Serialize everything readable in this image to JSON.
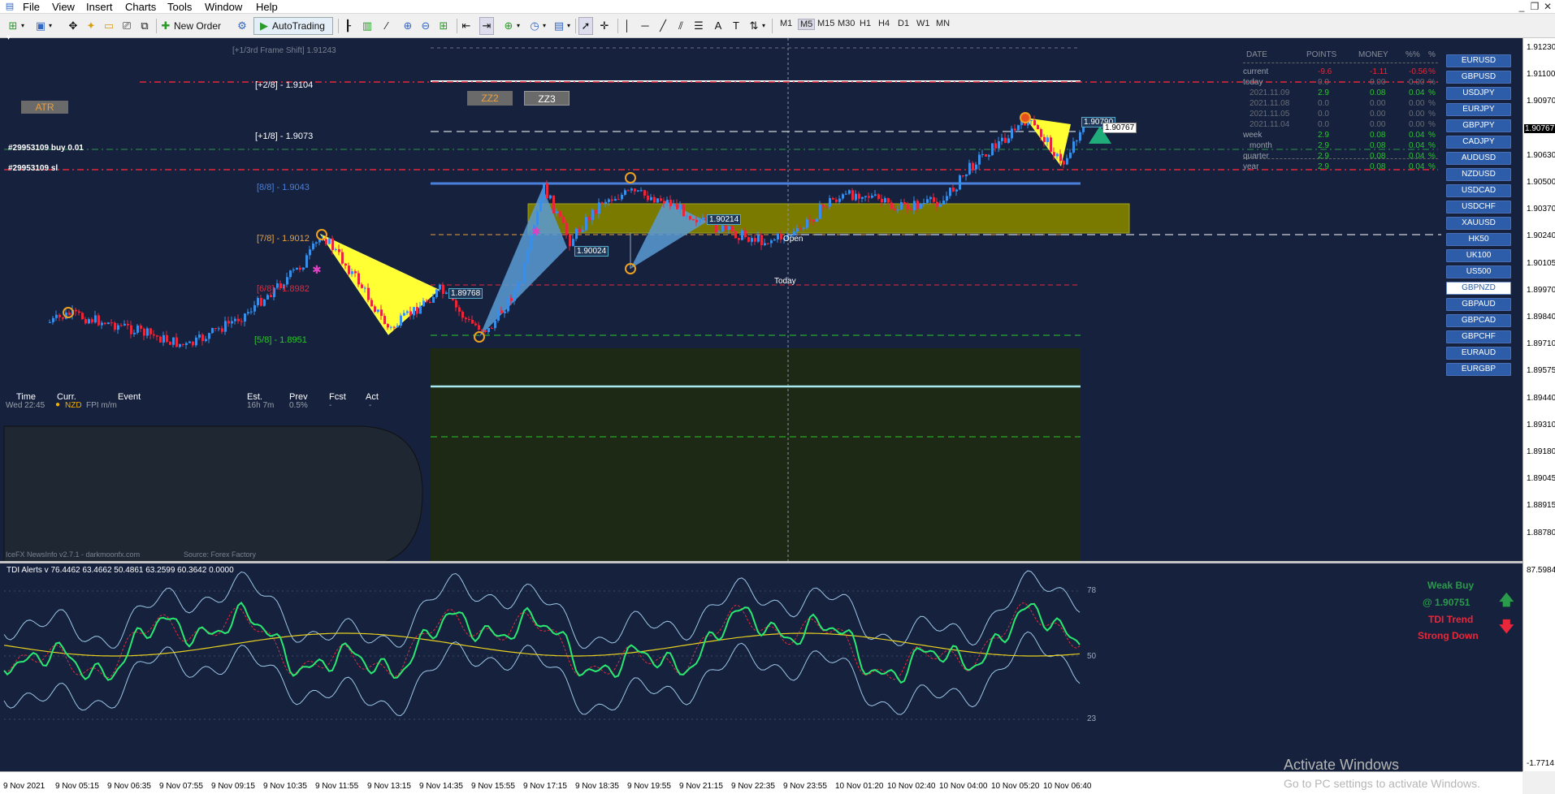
{
  "menu": {
    "items": [
      "File",
      "View",
      "Insert",
      "Charts",
      "Tools",
      "Window",
      "Help"
    ]
  },
  "toolbar": {
    "new_order": "New Order",
    "autotrading": "AutoTrading",
    "timeframes": [
      "M1",
      "M5",
      "M15",
      "M30",
      "H1",
      "H4",
      "D1",
      "W1",
      "MN"
    ],
    "active_timeframe": "M5"
  },
  "chart": {
    "price_axis": [
      "1.91230",
      "1.91100",
      "1.90970",
      "1.90767",
      "1.90630",
      "1.90500",
      "1.90370",
      "1.90240",
      "1.90105",
      "1.89970",
      "1.89840",
      "1.89710",
      "1.89575",
      "1.89440",
      "1.89310",
      "1.89180",
      "1.89045",
      "1.88915",
      "1.88780"
    ],
    "time_axis": [
      "9 Nov 2021",
      "9 Nov 05:15",
      "9 Nov 06:35",
      "9 Nov 07:55",
      "9 Nov 09:15",
      "9 Nov 10:35",
      "9 Nov 11:55",
      "9 Nov 13:15",
      "9 Nov 14:35",
      "9 Nov 15:55",
      "9 Nov 17:15",
      "9 Nov 18:35",
      "9 Nov 19:55",
      "9 Nov 21:15",
      "9 Nov 22:35",
      "9 Nov 23:55",
      "10 Nov 01:20",
      "10 Nov 02:40",
      "10 Nov 04:00",
      "10 Nov 05:20",
      "10 Nov 06:40"
    ],
    "current_price": "1.90767",
    "atr_label": "ATR",
    "zz2": "ZZ2",
    "zz3": "ZZ3",
    "frame_shift": "[+1/3rd Frame Shift]  1.91243",
    "murrey": {
      "p2_8": "[+2/8] - 1.9104",
      "p1_8": "[+1/8] - 1.9073",
      "p8_8": "[8/8] - 1.9043",
      "p7_8": "[7/8] - 1.9012",
      "p6_8": "[6/8] - 1.8982",
      "p5_8": "[5/8] - 1.8951"
    },
    "order_buy": "#29953109 buy 0.01",
    "order_sl": "#29953109 sl",
    "price_tags": [
      "1.90024",
      "1.90214",
      "1.89768",
      "1.90790",
      "1.90767"
    ],
    "open_label": "Open",
    "today_label": "Today",
    "colors": {
      "bg": "#15213d",
      "yellow": "#ffff33",
      "blue_fill": "#5b9bd5",
      "bull": "#3a8ee6",
      "bear": "#e8283a",
      "green_zone": "#1e2b18",
      "olive_zone": "#8b8b00"
    }
  },
  "stats": {
    "headers": [
      "DATE",
      "POINTS",
      "MONEY",
      "%%",
      "%"
    ],
    "rows": [
      {
        "date": "current",
        "points": "-9.6",
        "money": "-1.11",
        "pct": "-0.56",
        "sym": "%"
      },
      {
        "date": "today",
        "points": "0.0",
        "money": "0.00",
        "pct": "0.00",
        "sym": "%"
      },
      {
        "date": "2021.11.09",
        "points": "2.9",
        "money": "0.08",
        "pct": "0.04",
        "sym": "%"
      },
      {
        "date": "2021.11.08",
        "points": "0.0",
        "money": "0.00",
        "pct": "0.00",
        "sym": "%"
      },
      {
        "date": "2021.11.05",
        "points": "0.0",
        "money": "0.00",
        "pct": "0.00",
        "sym": "%"
      },
      {
        "date": "2021.11.04",
        "points": "0.0",
        "money": "0.00",
        "pct": "0.00",
        "sym": "%"
      },
      {
        "date": "week",
        "points": "2.9",
        "money": "0.08",
        "pct": "0.04",
        "sym": "%"
      },
      {
        "date": "month",
        "points": "2.9",
        "money": "0.08",
        "pct": "0.04",
        "sym": "%"
      },
      {
        "date": "quarter",
        "points": "2.9",
        "money": "0.08",
        "pct": "0.04",
        "sym": "%"
      },
      {
        "date": "year",
        "points": "2.9",
        "money": "0.08",
        "pct": "0.04",
        "sym": "%"
      }
    ]
  },
  "symbols": [
    "EURUSD",
    "GBPUSD",
    "USDJPY",
    "EURJPY",
    "GBPJPY",
    "CADJPY",
    "AUDUSD",
    "NZDUSD",
    "USDCAD",
    "USDCHF",
    "XAUUSD",
    "HK50",
    "UK100",
    "US500",
    "GBPNZD",
    "GBPAUD",
    "GBPCAD",
    "GBPCHF",
    "EURAUD",
    "EURGBP"
  ],
  "active_symbol": "GBPNZD",
  "news": {
    "headers": [
      "Time",
      "Curr.",
      "Event",
      "Est.",
      "Prev",
      "Fcst",
      "Act"
    ],
    "row": {
      "time": "Wed 22:45",
      "curr": "NZD",
      "event": "FPI m/m",
      "est": "16h 7m",
      "prev": "0.5%",
      "fcst": "-",
      "act": "-"
    },
    "footer": "IceFX NewsInfo v2.7.1  -  darkmoonfx.com",
    "source": "Source: Forex Factory"
  },
  "indicator": {
    "title": "TDI Alerts v 76.4462 63.4662 50.4861 63.2599 60.3642 0.0000",
    "axis_top": "87.5984",
    "levels": [
      "78",
      "50",
      "23"
    ],
    "axis_bottom": "-1.7714",
    "weak_buy": "Weak Buy",
    "weak_buy_price": "@ 1.90751",
    "trend": "TDI Trend",
    "trend_state": "Strong Down"
  },
  "activate": {
    "title": "Activate Windows",
    "subtitle": "Go to PC settings to activate Windows."
  }
}
